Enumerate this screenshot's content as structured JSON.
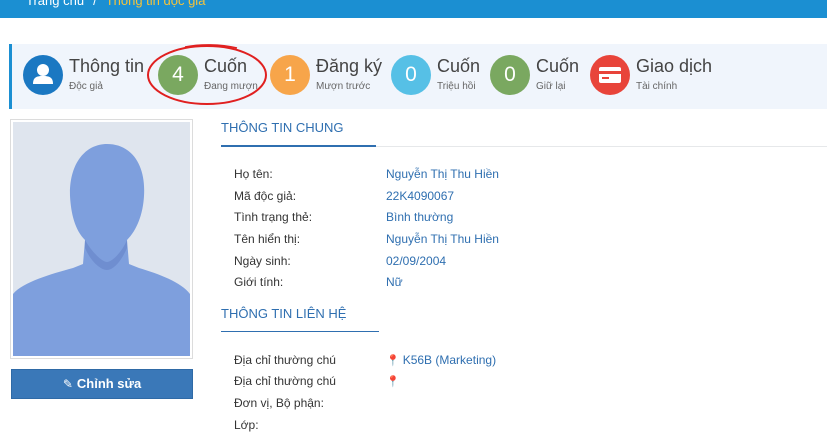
{
  "breadcrumb": {
    "home": "Trang chủ",
    "separator": "/",
    "current": "Thông tin độc giả"
  },
  "stats": [
    {
      "number": "",
      "title": "Thông tin",
      "sub": "Độc giả",
      "color": "#1b78c2",
      "icon": "user-icon"
    },
    {
      "number": "4",
      "title": "Cuốn",
      "sub": "Đang mượn",
      "color": "#7aa860",
      "highlighted": true
    },
    {
      "number": "1",
      "title": "Đăng ký",
      "sub": "Mượn trước",
      "color": "#f7a54a"
    },
    {
      "number": "0",
      "title": "Cuốn",
      "sub": "Triệu hồi",
      "color": "#56c0e6"
    },
    {
      "number": "0",
      "title": "Cuốn",
      "sub": "Giữ lại",
      "color": "#7aa860"
    },
    {
      "number": "",
      "title": "Giao dịch",
      "sub": "Tài chính",
      "color": "#e8443a",
      "icon": "credit-card-icon"
    }
  ],
  "highlight_color": "#e02020",
  "avatar": {
    "icon": "default-avatar-silhouette",
    "color": "#7e9fdd"
  },
  "edit_button": {
    "label": "Chỉnh sửa",
    "icon": "pencil-icon"
  },
  "general": {
    "title": "THÔNG TIN CHUNG",
    "fields": [
      {
        "label": "Họ tên:",
        "value": "Nguyễn Thị Thu Hiền"
      },
      {
        "label": "Mã độc giả:",
        "value": "22K4090067"
      },
      {
        "label": "Tình trạng thẻ:",
        "value": "Bình thường"
      },
      {
        "label": "Tên hiển thị:",
        "value": "Nguyễn Thị Thu Hiền"
      },
      {
        "label": "Ngày sinh:",
        "value": "02/09/2004"
      },
      {
        "label": "Giới tính:",
        "value": "Nữ"
      }
    ]
  },
  "contact": {
    "title": "THÔNG TIN LIÊN HỆ",
    "fields": [
      {
        "label": "Địa chỉ thường chú",
        "value": "K56B (Marketing)",
        "icon": "map-marker-icon"
      },
      {
        "label": "Địa chỉ thường chú",
        "value": "",
        "icon": "map-marker-icon"
      },
      {
        "label": "Đơn vị, Bộ phận:",
        "value": ""
      },
      {
        "label": "Lớp:",
        "value": ""
      }
    ]
  },
  "accent_color": "#2f6fb0"
}
